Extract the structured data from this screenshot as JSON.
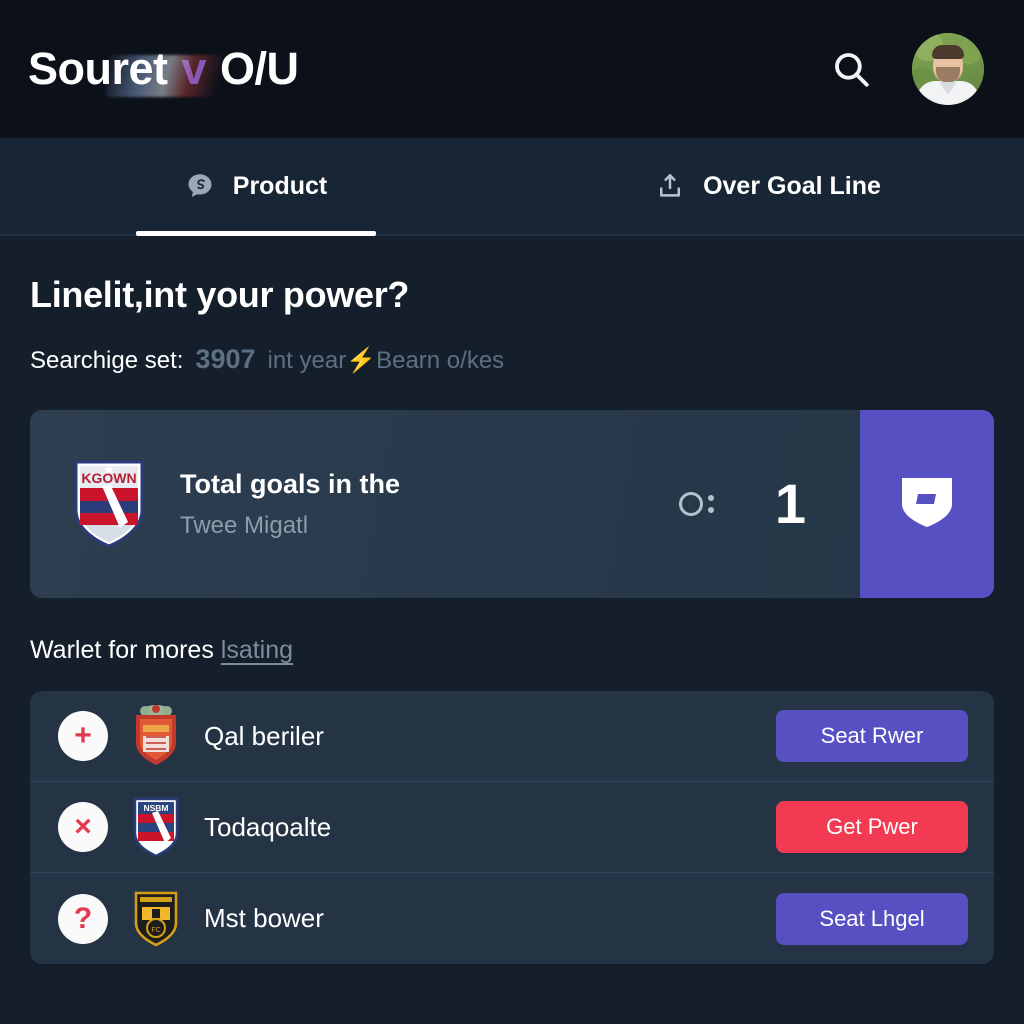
{
  "header": {
    "brand_word": "Souret",
    "brand_vs": "v",
    "brand_market": "O/U",
    "search_icon": "search-icon",
    "avatar_alt": "user-avatar"
  },
  "tabs": [
    {
      "label": "Product",
      "icon": "chat-bubble-icon",
      "active": true
    },
    {
      "label": "Over Goal Line",
      "icon": "upload-share-icon",
      "active": false
    }
  ],
  "main": {
    "headline": "Linelit,int your power?",
    "sub_prefix": "Searchige set:",
    "sub_number": "3907",
    "sub_rest": "int year⚡Bearn o/kes",
    "more_text": "Warlet for mores",
    "more_link": "lsating"
  },
  "feature": {
    "crest": "kgown-shield-crest",
    "crest_text": "KGOWN",
    "title": "Total goals in the",
    "subtitle": "Twee Migatl",
    "odds_mark": "O:",
    "value": "1",
    "action_icon": "shield-badge-icon"
  },
  "rows": [
    {
      "status_icon": "plus-icon",
      "status_glyph": "+",
      "crest": "red-orange-crest",
      "label": "Qal beriler",
      "button_label": "Seat Rwer",
      "button_style": "purple"
    },
    {
      "status_icon": "close-x-icon",
      "status_glyph": "×",
      "crest": "blue-red-shield-crest",
      "label": "Todaqoalte",
      "button_label": "Get Pwer",
      "button_style": "red"
    },
    {
      "status_icon": "question-mark-icon",
      "status_glyph": "?",
      "crest": "black-gold-crest",
      "label": "Mst bower",
      "button_label": "Seat Lhgel",
      "button_style": "purple"
    }
  ],
  "colors": {
    "page_bg": "#141f2b",
    "header_bg": "#0c1119",
    "tabbar_bg": "#182534",
    "card_bg": "#2b3b4d",
    "list_bg": "#243445",
    "accent_purple": "#5750c2",
    "accent_red": "#f23a52",
    "muted_text": "#8e9cab"
  }
}
